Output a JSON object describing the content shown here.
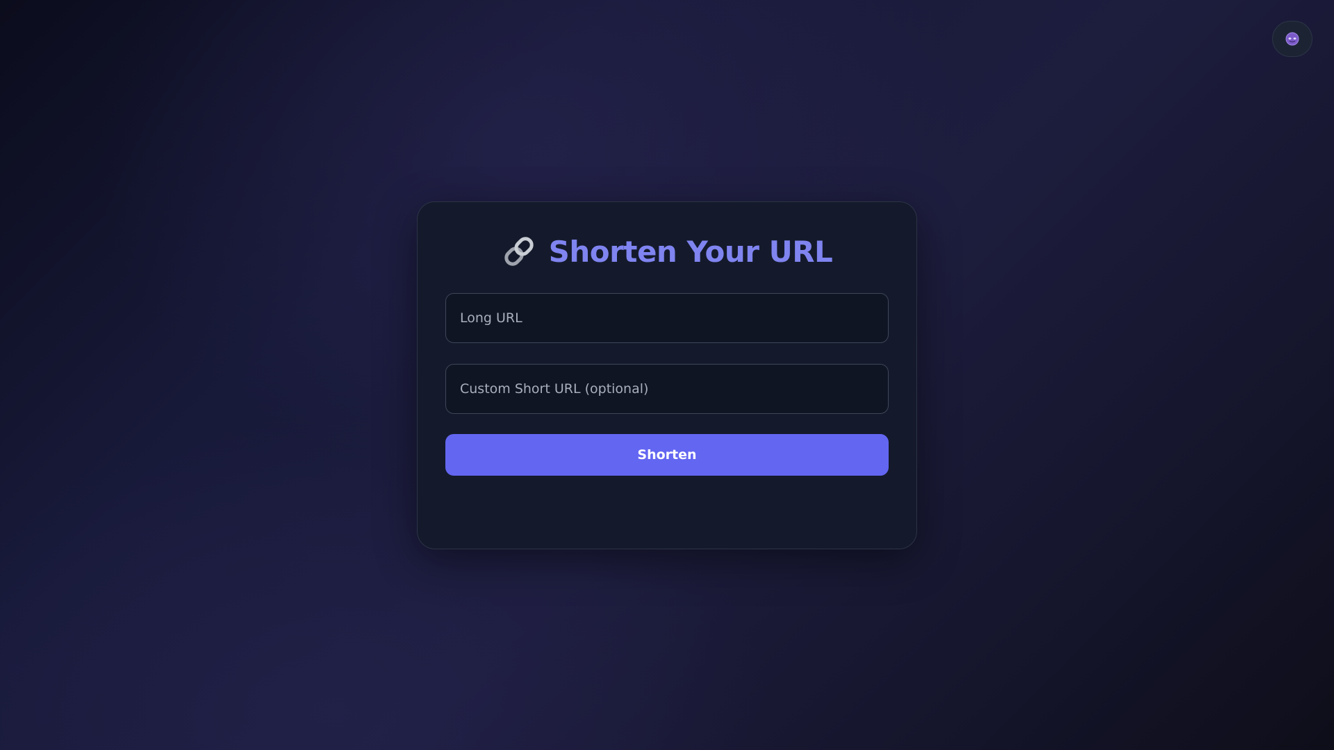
{
  "theme_toggle": {
    "icon": "moon-face-icon"
  },
  "card": {
    "icon": "link-icon",
    "title": "Shorten Your URL",
    "long_url": {
      "value": "",
      "placeholder": "Long URL"
    },
    "custom_short_url": {
      "value": "",
      "placeholder": "Custom Short URL (optional)"
    },
    "submit_label": "Shorten"
  },
  "colors": {
    "accent": "#6366f1",
    "title": "#7f84f0",
    "card_background": "#141a2b",
    "page_background": "#1b1b3a"
  }
}
